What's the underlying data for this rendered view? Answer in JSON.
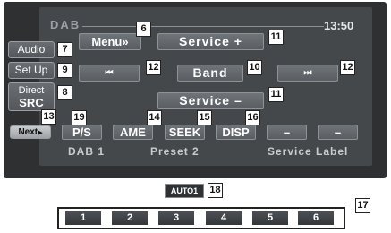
{
  "header": {
    "source": "DAB",
    "clock": "13:50"
  },
  "side": {
    "audio": "Audio",
    "setup": "Set Up",
    "direct_src_1": "Direct",
    "direct_src_2": "SRC",
    "next": "Next"
  },
  "buttons": {
    "menu": "Menu»",
    "service_plus": "Service +",
    "prev": "⏮",
    "band": "Band",
    "next": "⏭",
    "service_minus": "Service –",
    "ps": "P/S",
    "ame": "AME",
    "seek": "SEEK",
    "disp": "DISP",
    "dash1": "–",
    "dash2": "–"
  },
  "status": {
    "dab": "DAB 1",
    "preset": "Preset 2",
    "service_label": "Service Label"
  },
  "auto_badge": "AUTO1",
  "presets": [
    "1",
    "2",
    "3",
    "4",
    "5",
    "6"
  ],
  "callouts": {
    "c6": "6",
    "c11a": "11",
    "c7": "7",
    "c12a": "12",
    "c10": "10",
    "c12b": "12",
    "c9": "9",
    "c8": "8",
    "c11b": "11",
    "c13": "13",
    "c19": "19",
    "c14": "14",
    "c15": "15",
    "c16": "16",
    "c18": "18",
    "c17": "17"
  }
}
